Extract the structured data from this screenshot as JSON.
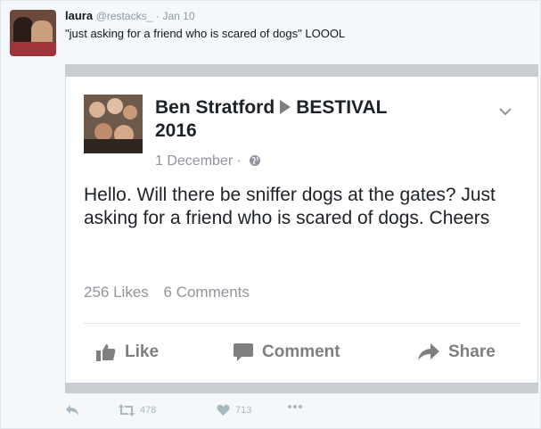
{
  "tweet": {
    "author_name": "laura",
    "author_handle": "@restacks_",
    "separator": "·",
    "timestamp": "Jan 10",
    "text": "\"just asking for a friend who is scared of dogs\" LOOOL",
    "actions": {
      "retweet_count": "478",
      "like_count": "713"
    }
  },
  "facebook_post": {
    "author": "Ben Stratford",
    "target_line1": "BESTIVAL",
    "target_line2": "2016",
    "date": "1 December ·",
    "body": "Hello. Will there be sniffer dogs at the gates? Just asking for a friend who is scared of dogs. Cheers",
    "likes": "256 Likes",
    "comments": "6 Comments",
    "actions": {
      "like_label": "Like",
      "comment_label": "Comment",
      "share_label": "Share"
    }
  },
  "colors": {
    "twitter_gray": "#aab8c2",
    "facebook_text": "#1d2129",
    "facebook_meta": "#90949c",
    "quote_bar": "#c9cdd2"
  }
}
